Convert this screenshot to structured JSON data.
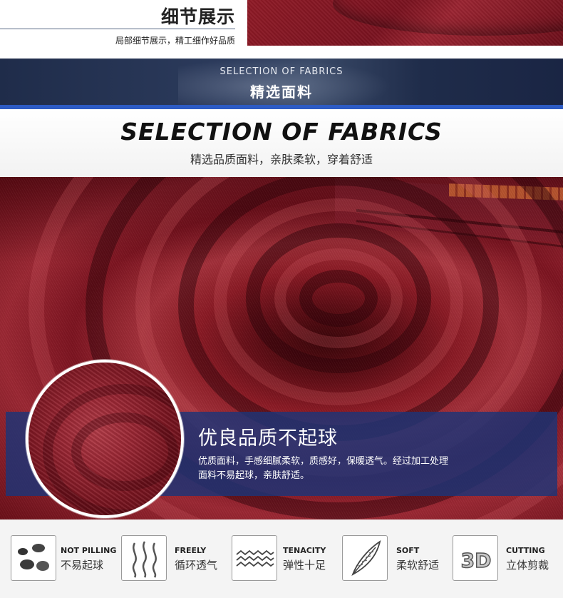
{
  "detail": {
    "title": "细节展示",
    "subtitle": "局部细节展示，精工细作好品质"
  },
  "banner": {
    "title_en": "SELECTION OF FABRICS",
    "title_cn": "精选面料"
  },
  "heading": {
    "title_en": "SELECTION OF FABRICS",
    "subtitle_cn": "精选品质面料，亲肤柔软，穿着舒适"
  },
  "info": {
    "title": "优良品质不起球",
    "desc_line1": "优质面料，手感细腻柔软，质感好，保暖透气。经过加工处理",
    "desc_line2": "面料不易起球，亲肤舒适。"
  },
  "features": [
    {
      "en": "NOT PILLING",
      "cn": "不易起球",
      "icon": "dots-icon"
    },
    {
      "en": "FREELY",
      "cn": "循环透气",
      "icon": "airflow-icon"
    },
    {
      "en": "TENACITY",
      "cn": "弹性十足",
      "icon": "wave-icon"
    },
    {
      "en": "SOFT",
      "cn": "柔软舒适",
      "icon": "feather-icon"
    },
    {
      "en": "CUTTING",
      "cn": "立体剪裁",
      "icon": "3d-icon"
    }
  ],
  "feature_3d_text": "3D",
  "colors": {
    "fabric_red": "#8a1a24",
    "banner_navy": "#1f2c4a",
    "accent_blue": "#2d5bc4",
    "info_box": "#1c3478"
  }
}
